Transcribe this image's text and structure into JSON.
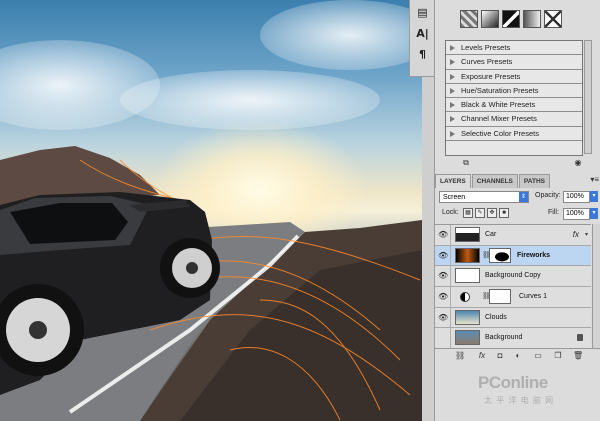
{
  "tool_strip": {
    "tools": [
      {
        "icon": "history-icon"
      },
      {
        "icon": "character-icon",
        "glyph": "A|"
      },
      {
        "icon": "paragraph-icon",
        "glyph": "¶"
      }
    ]
  },
  "adjustments": {
    "icons": [
      "vibrance-icon",
      "gradient-map-icon",
      "posterize-icon",
      "threshold-icon",
      "selective-color-icon"
    ],
    "presets": [
      "Levels Presets",
      "Curves Presets",
      "Exposure Presets",
      "Hue/Saturation Presets",
      "Black & White Presets",
      "Channel Mixer Presets",
      "Selective Color Presets"
    ]
  },
  "layers_panel": {
    "tabs": [
      "LAYERS",
      "CHANNELS",
      "PATHS"
    ],
    "active_tab": "LAYERS",
    "blend_mode": "Screen",
    "opacity_label": "Opacity:",
    "opacity_value": "100%",
    "lock_label": "Lock:",
    "fill_label": "Fill:",
    "fill_value": "100%",
    "layers": [
      {
        "name": "Car",
        "visible": true,
        "fx": "fx",
        "selected": false
      },
      {
        "name": "Fireworks",
        "visible": true,
        "selected": true,
        "has_mask": true
      },
      {
        "name": "Background Copy",
        "visible": true,
        "selected": false
      },
      {
        "name": "Curves 1",
        "visible": true,
        "selected": false,
        "adjustment": true
      },
      {
        "name": "Clouds",
        "visible": true,
        "selected": false
      },
      {
        "name": "Background",
        "visible": false,
        "selected": false,
        "locked": true
      }
    ]
  },
  "watermark": {
    "main": "PConline",
    "sub": "太 平 洋 电 脑 网"
  },
  "colors": {
    "selection": "#bcd6f2",
    "accent_blue": "#3b78d8",
    "panel_bg": "#dcdcdc"
  }
}
